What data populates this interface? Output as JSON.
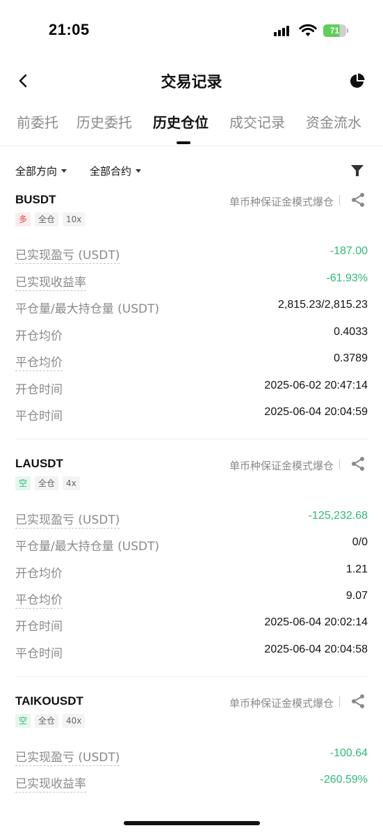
{
  "status": {
    "time": "21:05",
    "battery": "71"
  },
  "nav": {
    "title": "交易记录"
  },
  "tabs": [
    {
      "label": "前委托"
    },
    {
      "label": "历史委托"
    },
    {
      "label": "历史仓位"
    },
    {
      "label": "成交记录"
    },
    {
      "label": "资金流水"
    }
  ],
  "filters": {
    "direction": "全部方向",
    "contract": "全部合约"
  },
  "records": [
    {
      "symbol": "BUSDT",
      "type": "单币种保证金模式爆仓",
      "tags": [
        "多",
        "全仓",
        "10x"
      ],
      "rows": [
        {
          "label": "已实现盈亏 (USDT)",
          "value": "-187.00"
        },
        {
          "label": "已实现收益率",
          "value": "-61.93%"
        },
        {
          "label": "平仓量/最大持仓量 (USDT)",
          "value": "2,815.23/2,815.23"
        },
        {
          "label": "开仓均价",
          "value": "0.4033"
        },
        {
          "label": "平仓均价",
          "value": "0.3789"
        },
        {
          "label": "开仓时间",
          "value": "2025-06-02 20:47:14"
        },
        {
          "label": "平仓时间",
          "value": "2025-06-04 20:04:59"
        }
      ]
    },
    {
      "symbol": "LAUSDT",
      "type": "单币种保证金模式爆仓",
      "tags": [
        "空",
        "全仓",
        "4x"
      ],
      "rows": [
        {
          "label": "已实现盈亏 (USDT)",
          "value": "-125,232.68"
        },
        {
          "label": "平仓量/最大持仓量 (USDT)",
          "value": "0/0"
        },
        {
          "label": "开仓均价",
          "value": "1.21"
        },
        {
          "label": "平仓均价",
          "value": "9.07"
        },
        {
          "label": "开仓时间",
          "value": "2025-06-04 20:02:14"
        },
        {
          "label": "平仓时间",
          "value": "2025-06-04 20:04:58"
        }
      ]
    },
    {
      "symbol": "TAIKOUSDT",
      "type": "单币种保证金模式爆仓",
      "tags": [
        "空",
        "全仓",
        "40x"
      ],
      "rows": [
        {
          "label": "已实现盈亏 (USDT)",
          "value": "-100.64"
        },
        {
          "label": "已实现收益率",
          "value": "-260.59%"
        }
      ]
    }
  ],
  "colors": {
    "loss": "#2dbb76",
    "long": "#e0454b",
    "short": "#2dbb76"
  }
}
